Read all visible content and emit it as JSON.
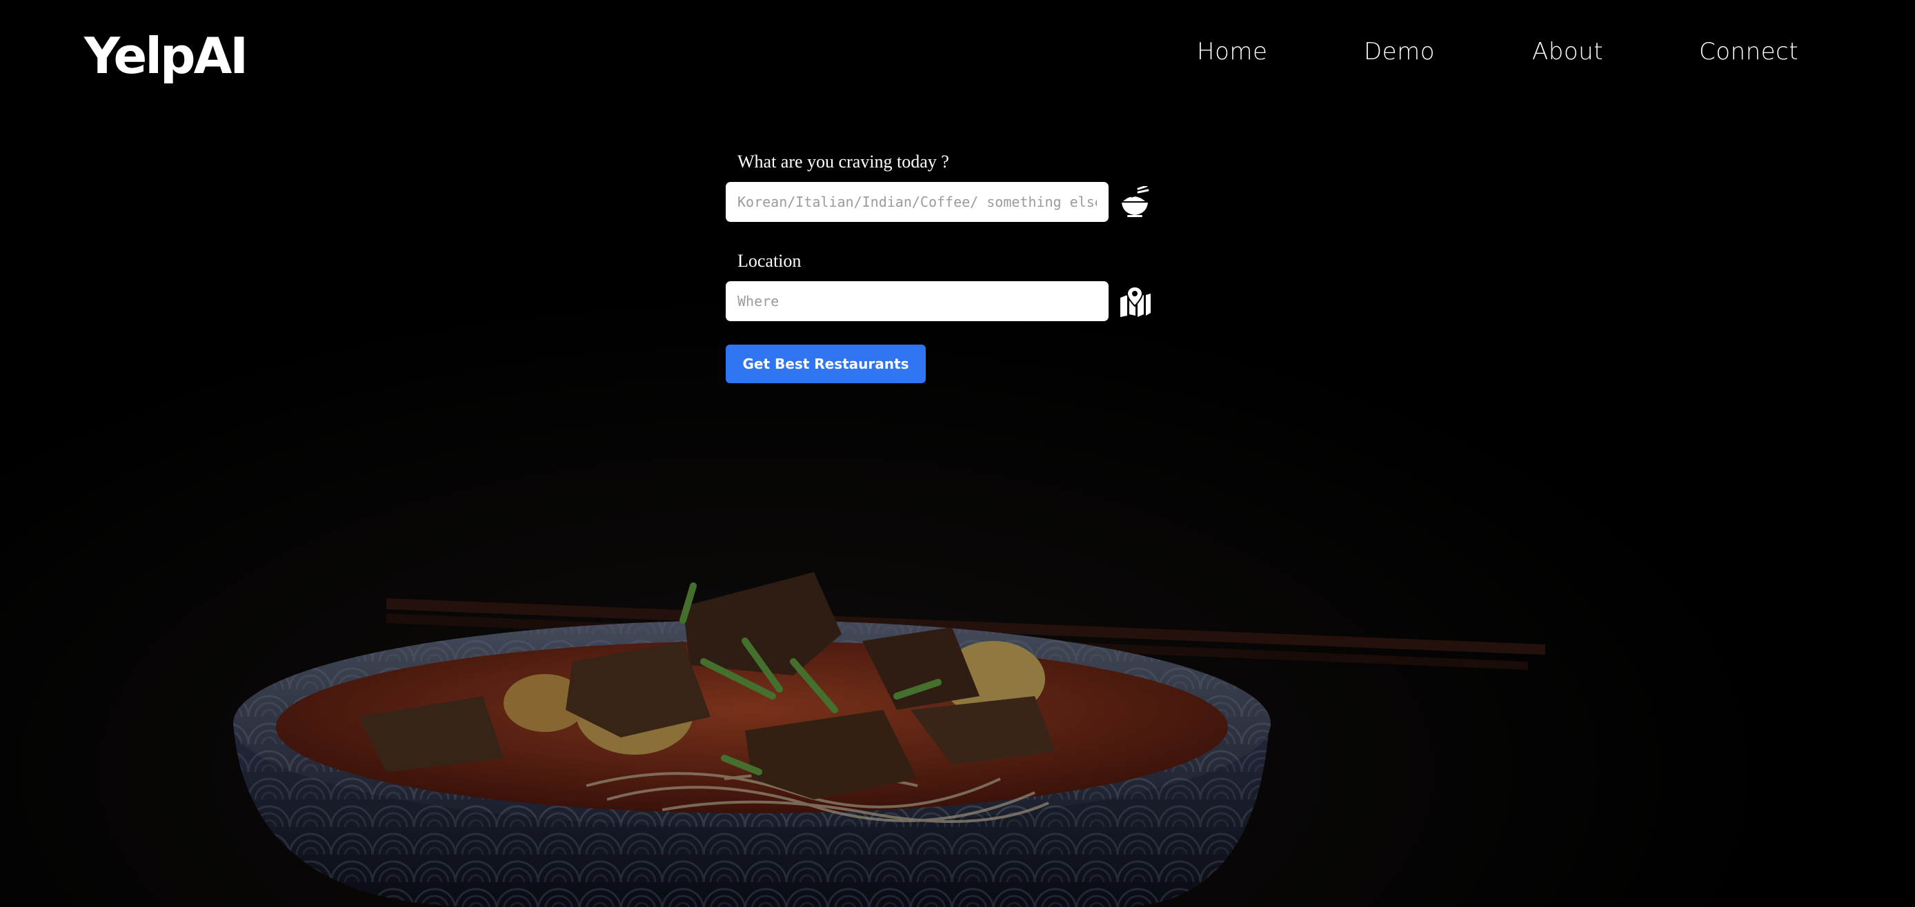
{
  "header": {
    "logo": "YelpAI",
    "nav": [
      {
        "label": "Home"
      },
      {
        "label": "Demo"
      },
      {
        "label": "About"
      },
      {
        "label": "Connect"
      }
    ]
  },
  "search": {
    "craving_label": "What are you craving today ?",
    "craving_placeholder": "Korean/Italian/Indian/Coffee/ something else..",
    "craving_value": "",
    "craving_icon": "food-bowl-icon",
    "location_label": "Location",
    "location_placeholder": "Where",
    "location_value": "",
    "location_icon": "map-marker-icon",
    "submit_label": "Get Best Restaurants"
  },
  "colors": {
    "background": "#000000",
    "button": "#2f74f0",
    "text": "#ffffff"
  }
}
